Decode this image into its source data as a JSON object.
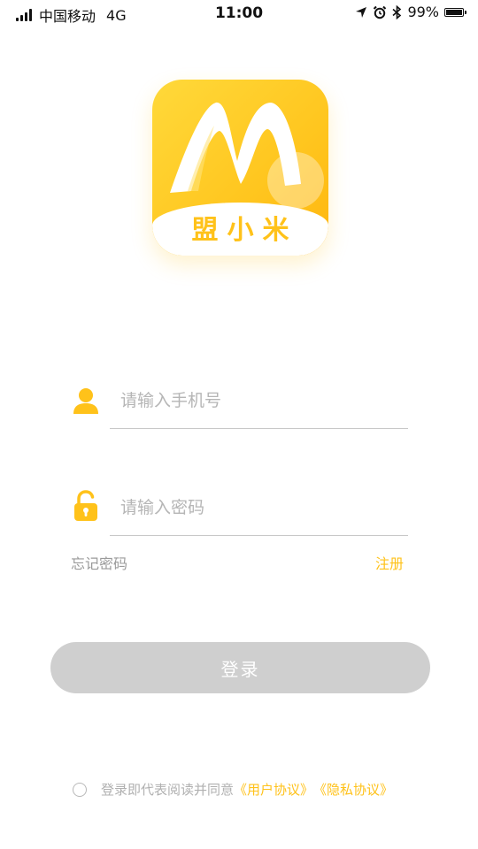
{
  "status_bar": {
    "carrier": "中国移动",
    "network": "4G",
    "time": "11:00",
    "battery": "99%",
    "battery_level": 0.99,
    "icons": [
      "location-icon",
      "alarm-icon",
      "bluetooth-icon",
      "battery-icon"
    ]
  },
  "logo": {
    "text": "盟小米"
  },
  "form": {
    "phone_placeholder": "请输入手机号",
    "password_placeholder": "请输入密码",
    "phone_value": "",
    "password_value": "",
    "forgot_label": "忘记密码",
    "register_label": "注册",
    "login_label": "登录"
  },
  "agreement": {
    "checked": false,
    "text": "登录即代表阅读并同意",
    "user_link": "《用户协议》",
    "privacy_link": "《隐私协议》"
  },
  "colors": {
    "accent": "#FFC21A",
    "button_disabled": "#CFCFCF",
    "placeholder": "#B5B5B5",
    "muted_text": "#9A9A9A"
  }
}
